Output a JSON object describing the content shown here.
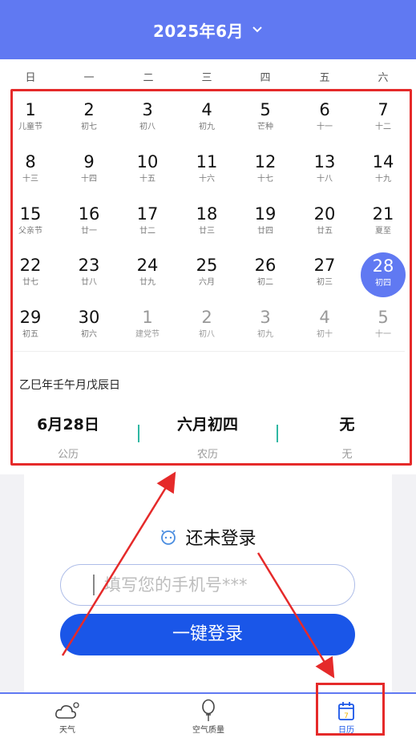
{
  "header": {
    "title": "2025年6月"
  },
  "weekdays": [
    "日",
    "一",
    "二",
    "三",
    "四",
    "五",
    "六"
  ],
  "calendar": {
    "rows": [
      [
        {
          "day": "1",
          "lunar": "儿童节"
        },
        {
          "day": "2",
          "lunar": "初七"
        },
        {
          "day": "3",
          "lunar": "初八"
        },
        {
          "day": "4",
          "lunar": "初九"
        },
        {
          "day": "5",
          "lunar": "芒种"
        },
        {
          "day": "6",
          "lunar": "十一"
        },
        {
          "day": "7",
          "lunar": "十二"
        }
      ],
      [
        {
          "day": "8",
          "lunar": "十三"
        },
        {
          "day": "9",
          "lunar": "十四"
        },
        {
          "day": "10",
          "lunar": "十五"
        },
        {
          "day": "11",
          "lunar": "十六"
        },
        {
          "day": "12",
          "lunar": "十七"
        },
        {
          "day": "13",
          "lunar": "十八"
        },
        {
          "day": "14",
          "lunar": "十九"
        }
      ],
      [
        {
          "day": "15",
          "lunar": "父亲节"
        },
        {
          "day": "16",
          "lunar": "廿一"
        },
        {
          "day": "17",
          "lunar": "廿二"
        },
        {
          "day": "18",
          "lunar": "廿三"
        },
        {
          "day": "19",
          "lunar": "廿四"
        },
        {
          "day": "20",
          "lunar": "廿五"
        },
        {
          "day": "21",
          "lunar": "夏至"
        }
      ],
      [
        {
          "day": "22",
          "lunar": "廿七"
        },
        {
          "day": "23",
          "lunar": "廿八"
        },
        {
          "day": "24",
          "lunar": "廿九"
        },
        {
          "day": "25",
          "lunar": "六月"
        },
        {
          "day": "26",
          "lunar": "初二"
        },
        {
          "day": "27",
          "lunar": "初三"
        },
        {
          "day": "28",
          "lunar": "初四",
          "selected": true
        }
      ],
      [
        {
          "day": "29",
          "lunar": "初五"
        },
        {
          "day": "30",
          "lunar": "初六"
        },
        {
          "day": "1",
          "lunar": "建党节",
          "dim": true
        },
        {
          "day": "2",
          "lunar": "初八",
          "dim": true
        },
        {
          "day": "3",
          "lunar": "初九",
          "dim": true
        },
        {
          "day": "4",
          "lunar": "初十",
          "dim": true
        },
        {
          "day": "5",
          "lunar": "十一",
          "dim": true
        }
      ]
    ]
  },
  "detail": {
    "ganzhi": "乙巳年壬午月戊辰日",
    "gregorian": "6月28日",
    "gregorian_label": "公历",
    "lunar": "六月初四",
    "lunar_label": "农历",
    "festival": "无",
    "festival_label": "无"
  },
  "login": {
    "title": "还未登录",
    "phone_placeholder": "填写您的手机号***",
    "button_label": "一键登录"
  },
  "tabbar": {
    "items": [
      {
        "label": "天气",
        "icon": "cloud-icon"
      },
      {
        "label": "空气质量",
        "icon": "balloon-icon"
      },
      {
        "label": "日历",
        "icon": "calendar-icon",
        "active": true
      }
    ]
  },
  "colors": {
    "accent": "#6079f2",
    "button": "#1a56e8",
    "annotation": "#e52a2a"
  }
}
